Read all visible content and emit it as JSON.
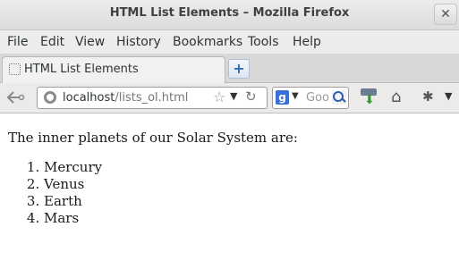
{
  "window": {
    "title": "HTML List Elements – Mozilla Firefox",
    "close_glyph": "✕"
  },
  "menu": {
    "items": [
      {
        "label": "File"
      },
      {
        "label": "Edit"
      },
      {
        "label": "View"
      },
      {
        "label": "History"
      },
      {
        "label": "Bookmarks"
      },
      {
        "label": "Tools"
      },
      {
        "label": "Help"
      }
    ]
  },
  "tabs": [
    {
      "title": "HTML List Elements",
      "active": true
    }
  ],
  "new_tab_glyph": "+",
  "navigation": {
    "url_host": "localhost",
    "url_path": "/lists_ol.html",
    "search_placeholder": "Goo",
    "search_engine_icon": "google-icon",
    "search_engine_letter": "g"
  },
  "page": {
    "intro": "The inner planets of our Solar System are:",
    "list_items": [
      "Mercury",
      "Venus",
      "Earth",
      "Mars"
    ]
  },
  "colors": {
    "titlebar": "#dcdcdb",
    "content_bg": "#ffffff",
    "accent": "#3a6ab0"
  }
}
